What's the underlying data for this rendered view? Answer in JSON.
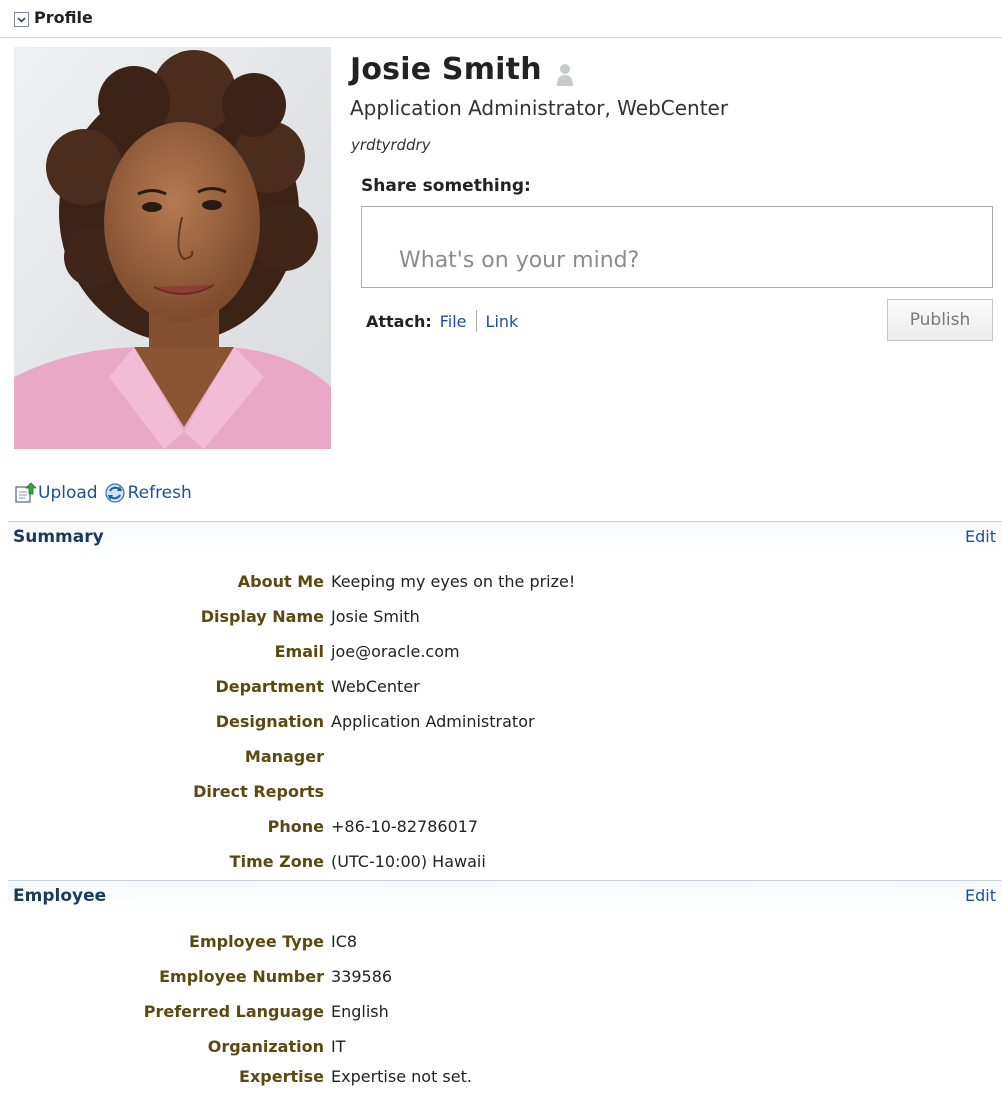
{
  "panel": {
    "title": "Profile"
  },
  "person": {
    "name": "Josie Smith",
    "job_title": "Application Administrator, WebCenter",
    "status_message": "yrdtyrddry"
  },
  "share": {
    "label": "Share something:",
    "placeholder": "What's on your mind?",
    "value": "",
    "attach_label": "Attach:",
    "file_link": "File",
    "link_link": "Link",
    "publish_label": "Publish"
  },
  "toolbar": {
    "upload_label": "Upload",
    "refresh_label": "Refresh"
  },
  "summary": {
    "title": "Summary",
    "edit_label": "Edit",
    "rows": [
      {
        "label": "About Me",
        "value": "Keeping my eyes on the prize!"
      },
      {
        "label": "Display Name",
        "value": "Josie Smith"
      },
      {
        "label": "Email",
        "value": "joe@oracle.com"
      },
      {
        "label": "Department",
        "value": "WebCenter"
      },
      {
        "label": "Designation",
        "value": "Application Administrator"
      },
      {
        "label": "Manager",
        "value": ""
      },
      {
        "label": "Direct Reports",
        "value": ""
      },
      {
        "label": "Phone",
        "value": "+86-10-82786017"
      },
      {
        "label": "Time Zone",
        "value": "(UTC-10:00) Hawaii"
      }
    ]
  },
  "employee": {
    "title": "Employee",
    "edit_label": "Edit",
    "rows": [
      {
        "label": "Employee Type",
        "value": "IC8"
      },
      {
        "label": "Employee Number",
        "value": "339586"
      },
      {
        "label": "Preferred Language",
        "value": "English"
      },
      {
        "label": "Organization",
        "value": "IT"
      },
      {
        "label": "Expertise",
        "value": "Expertise not set."
      }
    ]
  },
  "colors": {
    "link": "#1f4f99",
    "field_label": "#5a4a11",
    "section_title": "#1b3a5c"
  },
  "icons": {
    "collapse": "chevron-down-icon",
    "presence": "presence-icon",
    "upload": "upload-icon",
    "refresh": "refresh-icon"
  }
}
